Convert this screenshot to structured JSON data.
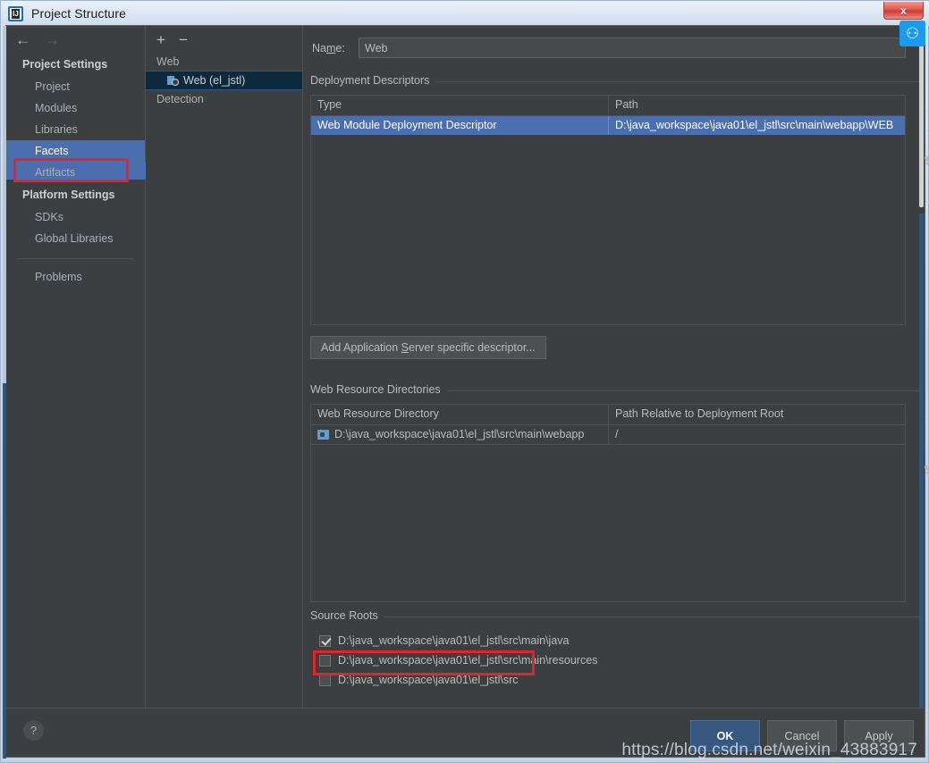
{
  "window": {
    "title": "Project Structure",
    "app_icon": "intellij-idea-icon",
    "close_label": "x"
  },
  "sidebar": {
    "back_icon": "back-arrow-icon",
    "forward_icon": "forward-arrow-icon",
    "groups": [
      {
        "title": "Project Settings",
        "items": [
          {
            "label": "Project",
            "selected": false
          },
          {
            "label": "Modules",
            "selected": false
          },
          {
            "label": "Libraries",
            "selected": false
          },
          {
            "label": "Facets",
            "selected": true
          },
          {
            "label": "Artifacts",
            "selected": false
          }
        ]
      },
      {
        "title": "Platform Settings",
        "items": [
          {
            "label": "SDKs",
            "selected": false
          },
          {
            "label": "Global Libraries",
            "selected": false
          }
        ]
      }
    ],
    "problems_label": "Problems"
  },
  "facet_panel": {
    "add_icon": "plus-icon",
    "remove_icon": "minus-icon",
    "group_label": "Web",
    "selected_facet": "Web (el_jstl)",
    "detection_label": "Detection"
  },
  "main": {
    "name_label": "Name:",
    "name_value": "Web",
    "deployment_descriptors": {
      "title": "Deployment Descriptors",
      "columns": [
        "Type",
        "Path"
      ],
      "rows": [
        {
          "type": "Web Module Deployment Descriptor",
          "path": "D:\\java_workspace\\java01\\el_jstl\\src\\main\\webapp\\WEB",
          "selected": true
        }
      ],
      "tools": [
        "plus-icon",
        "minus-icon",
        "edit-pencil-icon"
      ],
      "add_descriptor_button": "Add Application Server specific descriptor..."
    },
    "web_resource_directories": {
      "title": "Web Resource Directories",
      "columns": [
        "Web Resource Directory",
        "Path Relative to Deployment Root"
      ],
      "rows": [
        {
          "directory": "D:\\java_workspace\\java01\\el_jstl\\src\\main\\webapp",
          "relative_path": "/",
          "icon": "folder-icon"
        }
      ],
      "tools": [
        "plus-icon",
        "minus-icon",
        "edit-pencil-icon",
        "help-icon"
      ]
    },
    "source_roots": {
      "title": "Source Roots",
      "items": [
        {
          "label": "D:\\java_workspace\\java01\\el_jstl\\src\\main\\java",
          "checked": true
        },
        {
          "label": "D:\\java_workspace\\java01\\el_jstl\\src\\main\\resources",
          "checked": false
        },
        {
          "label": "D:\\java_workspace\\java01\\el_jstl\\src",
          "checked": false
        }
      ]
    }
  },
  "footer": {
    "help_label": "?",
    "ok_label": "OK",
    "cancel_label": "Cancel",
    "apply_label": "Apply"
  },
  "overlay": {
    "watermark": "https://blog.csdn.net/weixin_43883917",
    "badge_icon": "csdn-logo-icon"
  },
  "colors": {
    "selection_blue": "#4b6eaf",
    "annotation_red": "#e8222a",
    "panel_bg": "#3c3f41",
    "primary_button": "#365880"
  }
}
